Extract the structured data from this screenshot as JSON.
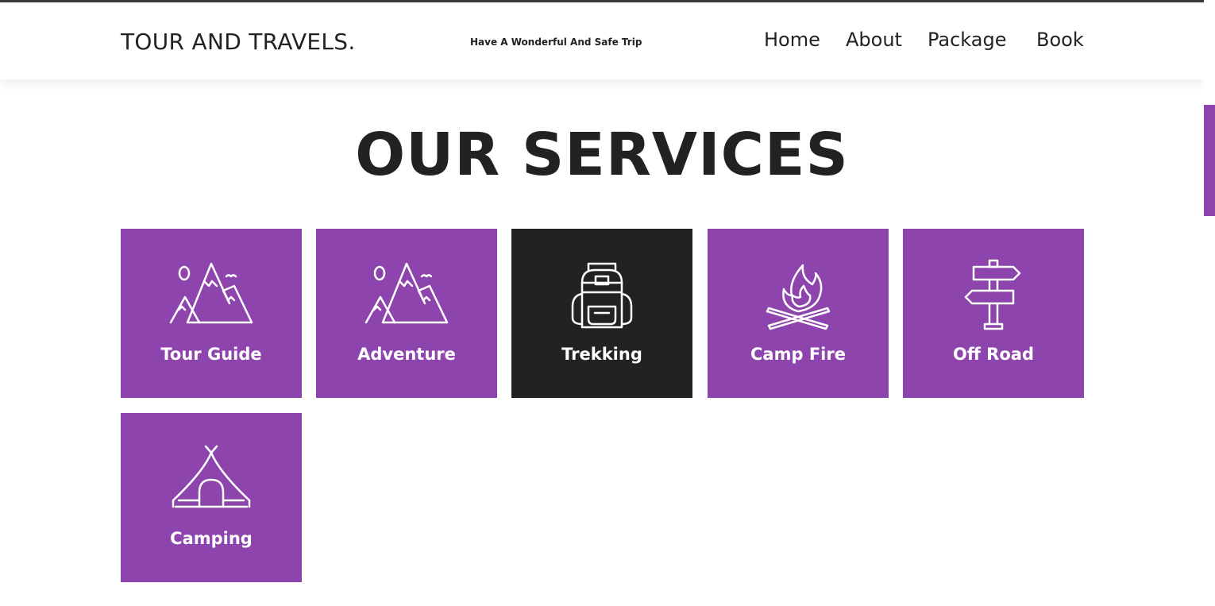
{
  "header": {
    "brand": "TOUR AND TRAVELS.",
    "tagline": "Have A Wonderful And Safe Trip",
    "nav": [
      "Home",
      "About",
      "Package",
      "Book"
    ]
  },
  "services": {
    "title": "OUR SERVICES",
    "items": [
      {
        "label": "Tour Guide",
        "icon": "mountains-icon",
        "highlighted": false
      },
      {
        "label": "Adventure",
        "icon": "mountains-icon",
        "highlighted": false
      },
      {
        "label": "Trekking",
        "icon": "backpack-icon",
        "highlighted": true
      },
      {
        "label": "Camp Fire",
        "icon": "campfire-icon",
        "highlighted": false
      },
      {
        "label": "Off Road",
        "icon": "signpost-icon",
        "highlighted": false
      },
      {
        "label": "Camping",
        "icon": "tent-icon",
        "highlighted": false
      }
    ]
  },
  "colors": {
    "accent": "#8e44ad",
    "highlight": "#222222",
    "text": "#222222",
    "background": "#ffffff"
  }
}
